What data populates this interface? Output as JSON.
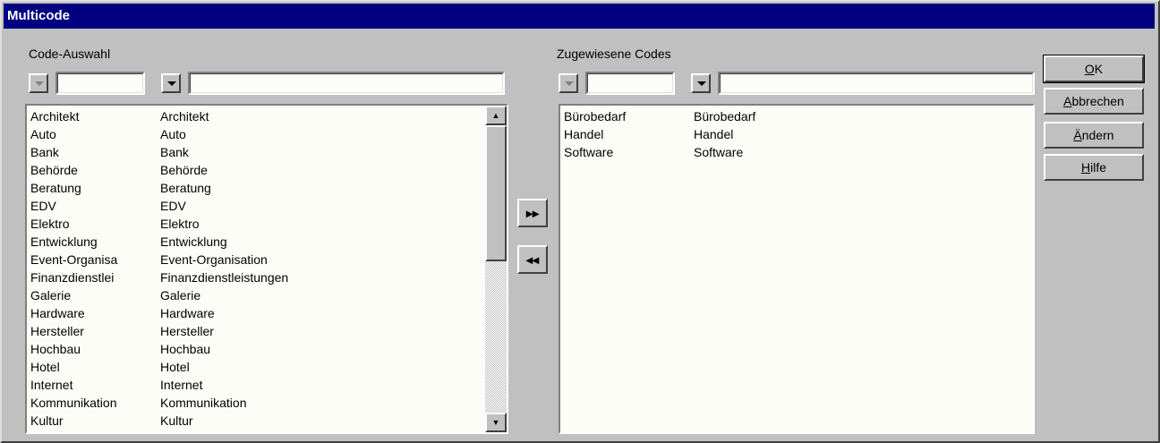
{
  "window": {
    "title": "Multicode"
  },
  "left": {
    "heading": "Code-Auswahl",
    "filter1_value": "",
    "filter2_value": "",
    "items": [
      {
        "code": "Architekt",
        "name": "Architekt"
      },
      {
        "code": "Auto",
        "name": "Auto"
      },
      {
        "code": "Bank",
        "name": "Bank"
      },
      {
        "code": "Behörde",
        "name": "Behörde"
      },
      {
        "code": "Beratung",
        "name": "Beratung"
      },
      {
        "code": "EDV",
        "name": "EDV"
      },
      {
        "code": "Elektro",
        "name": "Elektro"
      },
      {
        "code": "Entwicklung",
        "name": "Entwicklung"
      },
      {
        "code": "Event-Organisa",
        "name": "Event-Organisation"
      },
      {
        "code": "Finanzdienstlei",
        "name": "Finanzdienstleistungen"
      },
      {
        "code": "Galerie",
        "name": "Galerie"
      },
      {
        "code": "Hardware",
        "name": "Hardware"
      },
      {
        "code": "Hersteller",
        "name": "Hersteller"
      },
      {
        "code": "Hochbau",
        "name": "Hochbau"
      },
      {
        "code": "Hotel",
        "name": "Hotel"
      },
      {
        "code": "Internet",
        "name": "Internet"
      },
      {
        "code": "Kommunikation",
        "name": "Kommunikation"
      },
      {
        "code": "Kultur",
        "name": "Kultur"
      }
    ]
  },
  "right": {
    "heading": "Zugewiesene Codes",
    "filter1_value": "",
    "filter2_value": "",
    "items": [
      {
        "code": "Bürobedarf",
        "name": "Bürobedarf"
      },
      {
        "code": "Handel",
        "name": "Handel"
      },
      {
        "code": "Software",
        "name": "Software"
      }
    ]
  },
  "transfer": {
    "add_glyph": "▸▸",
    "remove_glyph": "◂◂"
  },
  "buttons": {
    "ok": {
      "mnemonic": "O",
      "rest": "K"
    },
    "cancel": {
      "mnemonic": "A",
      "rest": "bbrechen"
    },
    "change": {
      "mnemonic": "Ä",
      "rest": "ndern"
    },
    "help": {
      "mnemonic": "H",
      "rest": "ilfe"
    }
  },
  "icons": [
    "dropdown-arrow-icon",
    "scroll-up-icon",
    "scroll-down-icon",
    "add-icon",
    "remove-icon"
  ]
}
